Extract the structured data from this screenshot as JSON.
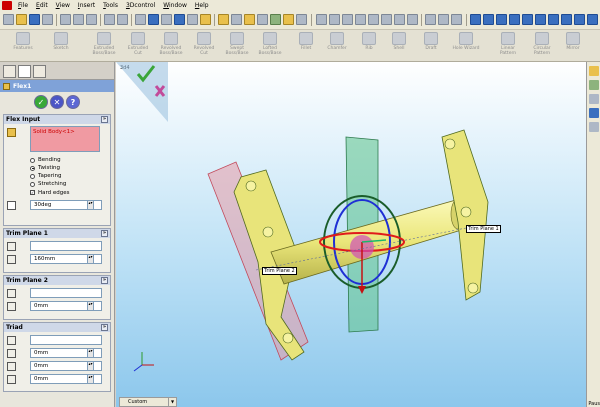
{
  "menu": [
    "File",
    "Edit",
    "View",
    "Insert",
    "Tools",
    "3Dcontrol",
    "Window",
    "Help"
  ],
  "features": [
    "Extruded Boss/Base",
    "Extruded Cut",
    "Revolved Boss/Base",
    "Revolved Cut",
    "Swept Boss/Base",
    "Lofted Boss/Base",
    "Fillet",
    "Chamfer",
    "Rib",
    "Shell",
    "Draft",
    "Hole Wizard",
    "Linear Pattern",
    "Circular Pattern",
    "Mirror"
  ],
  "toolbar_left": [
    "Features",
    "Sketch"
  ],
  "panel": {
    "title": "Flex1",
    "flex_input": {
      "header": "Flex Input",
      "body_value": "Solid Body<1>",
      "options": [
        "Bending",
        "Twisting",
        "Tapering",
        "Stretching"
      ],
      "selected": "Twisting",
      "hard_edges": "Hard edges",
      "angle": "30deg"
    },
    "trim1": {
      "header": "Trim Plane 1",
      "distance": "160mm"
    },
    "trim2": {
      "header": "Trim Plane 2",
      "distance": "0mm"
    },
    "triad": {
      "header": "Triad",
      "v1": "0mm",
      "v2": "0mm",
      "v3": "0mm"
    }
  },
  "graphics": {
    "tree_label": "3d4",
    "trim_label_1": "Trim Plane 1",
    "trim_label_2": "Trim Plane 2",
    "view_dropdown": "Custom"
  },
  "status": "Paus",
  "colors": {
    "accent": "#7fa2d8",
    "part": "#e9e57a",
    "plane1": "#e08a9a",
    "plane2": "#5cc38a"
  }
}
